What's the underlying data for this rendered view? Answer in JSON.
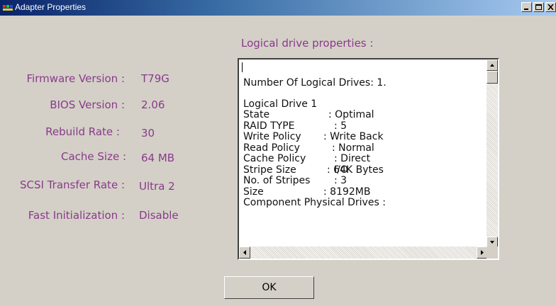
{
  "window": {
    "title": "Adapter Properties"
  },
  "adapter": {
    "firmware_label": "Firmware Version :",
    "firmware_value": "T79G",
    "bios_label": "BIOS Version :",
    "bios_value": "2.06",
    "rebuild_label": "Rebuild Rate :",
    "rebuild_value": "30",
    "cache_label": "Cache Size :",
    "cache_value": "64 MB",
    "scsi_label": "SCSI Transfer Rate :",
    "scsi_value": "Ultra 2",
    "fastinit_label": "Fast Initialization :",
    "fastinit_value": "Disable"
  },
  "logical": {
    "heading": "Logical drive properties :",
    "count_line": "Number Of Logical Drives: 1.",
    "drive_title": "Logical Drive 1",
    "rows": [
      {
        "k": "State",
        "v": ": Optimal"
      },
      {
        "k": "RAID TYPE",
        "v": ": 5"
      },
      {
        "k": "Write Policy",
        "v": ": Write Back"
      },
      {
        "k": "Read Policy",
        "v": ": Normal"
      },
      {
        "k": "Cache Policy",
        "v": ": Direct I/O"
      },
      {
        "k": "Stripe Size",
        "v": ": 64K Bytes"
      },
      {
        "k": "No. of Stripes",
        "v": ": 3"
      },
      {
        "k": "Size",
        "v": ": 8192MB"
      }
    ],
    "component_line": "Component Physical Drives :"
  },
  "buttons": {
    "ok_label": "OK"
  },
  "colors": {
    "label_color": "#8a3a8a",
    "title_gradient_start": "#0a246a",
    "title_gradient_end": "#a6caf0"
  }
}
